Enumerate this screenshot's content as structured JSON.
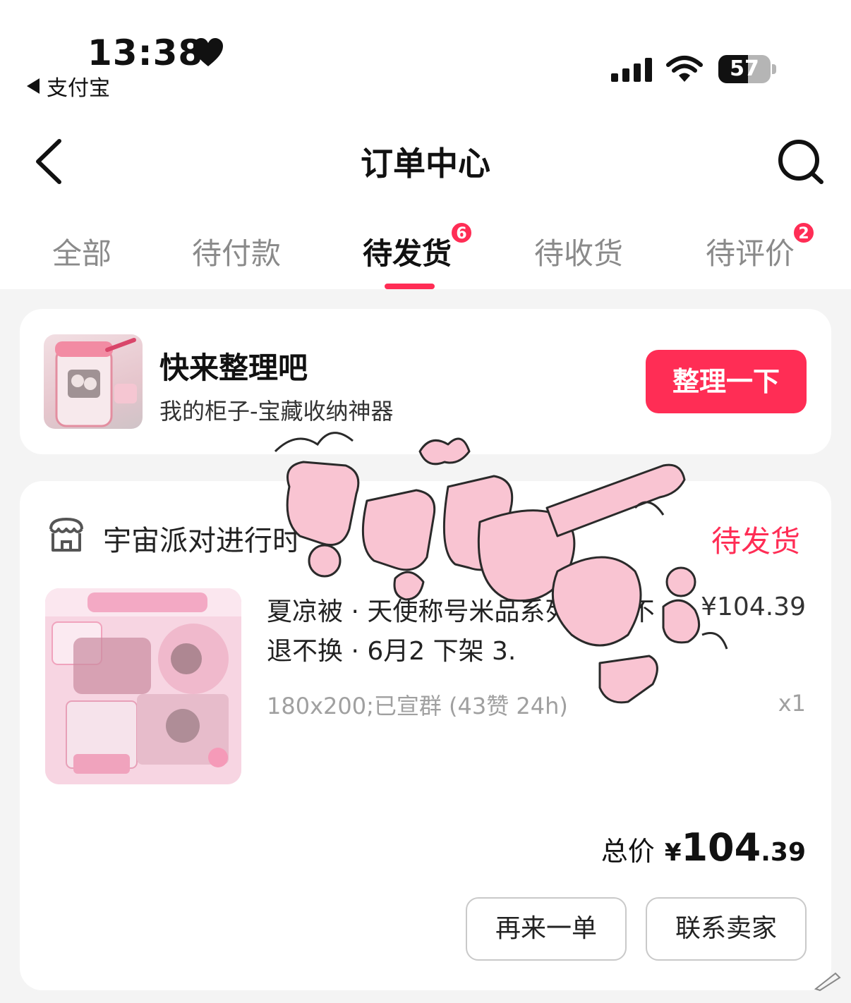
{
  "status_bar": {
    "time": "13:38",
    "back_app": "支付宝",
    "battery_level": "57",
    "battery_percent": 57
  },
  "nav": {
    "title": "订单中心"
  },
  "tabs": [
    {
      "label": "全部",
      "active": false
    },
    {
      "label": "待付款",
      "active": false
    },
    {
      "label": "待发货",
      "active": true,
      "badge": "6"
    },
    {
      "label": "待收货",
      "active": false
    },
    {
      "label": "待评价",
      "active": false,
      "badge": "2"
    }
  ],
  "promo": {
    "title": "快来整理吧",
    "subtitle": "我的柜子-宝藏收纳神器",
    "button": "整理一下"
  },
  "order": {
    "store_name": "宇宙派对进行时",
    "status": "待发货",
    "product_title": "夏凉被 · 天使称号米品系列 拍下不退不换 · 6月2 下架 3.",
    "price": "¥104.39",
    "spec": "180x200;已宣群 (43赞 24h)",
    "quantity": "x1",
    "total_label": "总价",
    "total_currency": "¥",
    "total_int": "104",
    "total_dec": ".39",
    "buttons": {
      "reorder": "再来一单",
      "contact": "联系卖家"
    }
  },
  "colors": {
    "accent": "#ff2d55",
    "background": "#f4f4f4",
    "card": "#ffffff",
    "muted_text": "#a0a0a0"
  },
  "icons": [
    "heart-icon",
    "signal-icon",
    "wifi-icon",
    "battery-icon",
    "back-arrow-icon",
    "search-icon",
    "store-icon"
  ]
}
